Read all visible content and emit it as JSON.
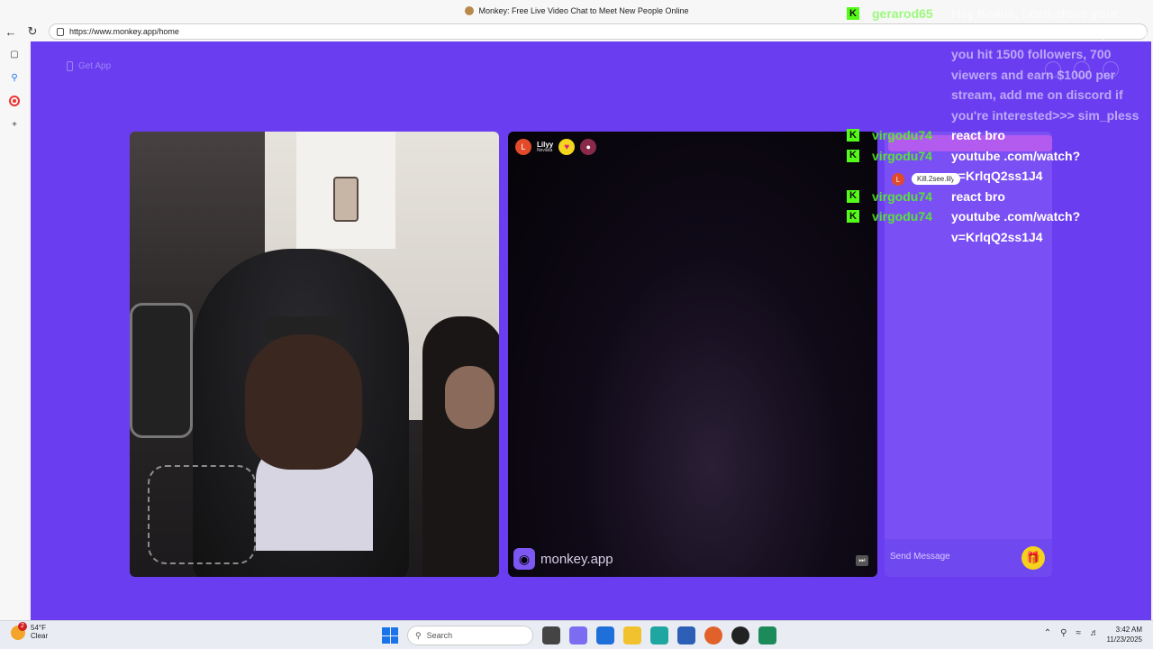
{
  "browser": {
    "title": "Monkey: Free Live Video Chat to Meet New People Online",
    "url": "https://www.monkey.app/home"
  },
  "page": {
    "get_app_label": "Get App",
    "remote_user": {
      "initial": "L",
      "name": "Lilyy",
      "location": "Nevada"
    },
    "brand": "monkey.app",
    "chat_initial": "L",
    "chat_message": "Kill.2see.lily",
    "send_placeholder": "Send Message"
  },
  "overlay_chat": [
    {
      "user": "gerarod65",
      "text": "Hey homie, i can share your stream to kick community to help you hit 1500 followers, 700 viewers and earn $1000 per stream, add me on discord if you're interested>>> sim_pless"
    },
    {
      "user": "virgodu74",
      "text": "react bro"
    },
    {
      "user": "virgodu74",
      "text": "youtube .com/watch? v=KrlqQ2ss1J4"
    },
    {
      "user": "virgodu74",
      "text": "react bro"
    },
    {
      "user": "virgodu74",
      "text": "youtube .com/watch? v=KrlqQ2ss1J4"
    }
  ],
  "overlay_badge": "K",
  "taskbar": {
    "temp": "54°F",
    "condition": "Clear",
    "weather_badge": "2",
    "search": "Search",
    "time": "3:42 AM",
    "date": "11/23/2025"
  },
  "colors": {
    "page_bg": "#6b3df0",
    "kick_green": "#53fc18"
  }
}
